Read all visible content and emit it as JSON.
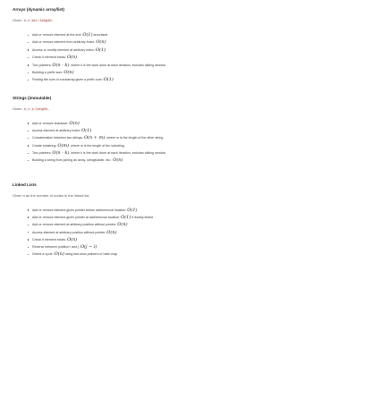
{
  "sections": [
    {
      "title": "Arrays (dynamic array/list)",
      "given_prefix": "Given ",
      "given_code": "n = arr.length",
      "given_suffix": ",",
      "items": [
        {
          "text": "Add or remove element at the end: ",
          "math": "O(1)",
          "after": " amortized"
        },
        {
          "text": "Add or remove element from arbitrary index: ",
          "math": "O(n)",
          "after": ""
        },
        {
          "text": "Access or modify element at arbitrary index: ",
          "math": "O(1)",
          "after": ""
        },
        {
          "text": "Check if element exists: ",
          "math": "O(n)",
          "after": ""
        },
        {
          "text": "Two pointers: ",
          "math": "O(n · k)",
          "after": ", where k is the work done at each iteration, includes sliding window"
        },
        {
          "text": "Building a prefix sum: ",
          "math": "O(n)",
          "after": ""
        },
        {
          "text": "Finding the sum of a subarray given a prefix sum: ",
          "math": "O(1)",
          "after": ""
        }
      ]
    },
    {
      "title": "Strings (immutable)",
      "given_prefix": "Given ",
      "given_code": "n = s.length",
      "given_suffix": ",",
      "items": [
        {
          "text": "Add or remove character: ",
          "math": "O(n)",
          "after": ""
        },
        {
          "text": "Access element at arbitrary index: ",
          "math": "O(1)",
          "after": ""
        },
        {
          "text": "Concatenation between two strings: ",
          "math": "O(n + m)",
          "after": ", where m is the length of the other string"
        },
        {
          "text": "Create substring: ",
          "math": "O(m)",
          "after": ", where m is the length of the substring"
        },
        {
          "text": "Two pointers: ",
          "math": "O(n · k)",
          "after": ", where k is the work done at each iteration, includes sliding window"
        },
        {
          "text": "Building a string from joining an array, stringbuilder, etc.: ",
          "math": "O(n)",
          "after": ""
        }
      ]
    },
    {
      "title": "Linked Lists",
      "given_prefix": "Given ",
      "given_code": "",
      "given_suffix": "n as the number of nodes in the linked list,",
      "items": [
        {
          "text": "Add or remove element given pointer before add/removal location: ",
          "math": "O(1)",
          "after": ""
        },
        {
          "text": "Add or remove element given pointer at add/removal location: ",
          "math": "O(1)",
          "after": " if doubly linked"
        },
        {
          "text": "Add or remove element at arbitrary position without pointer: ",
          "math": "O(n)",
          "after": ""
        },
        {
          "text": "Access element at arbitrary position without pointer: ",
          "math": "O(n)",
          "after": ""
        },
        {
          "text": "Check if element exists: ",
          "math": "O(n)",
          "after": ""
        },
        {
          "text": "Reverse between position i and j: ",
          "math": "O(j − i)",
          "after": ""
        },
        {
          "text": "Detect a cycle: ",
          "math": "O(n)",
          "after": " using fast-slow pointers or hash map"
        }
      ]
    }
  ]
}
